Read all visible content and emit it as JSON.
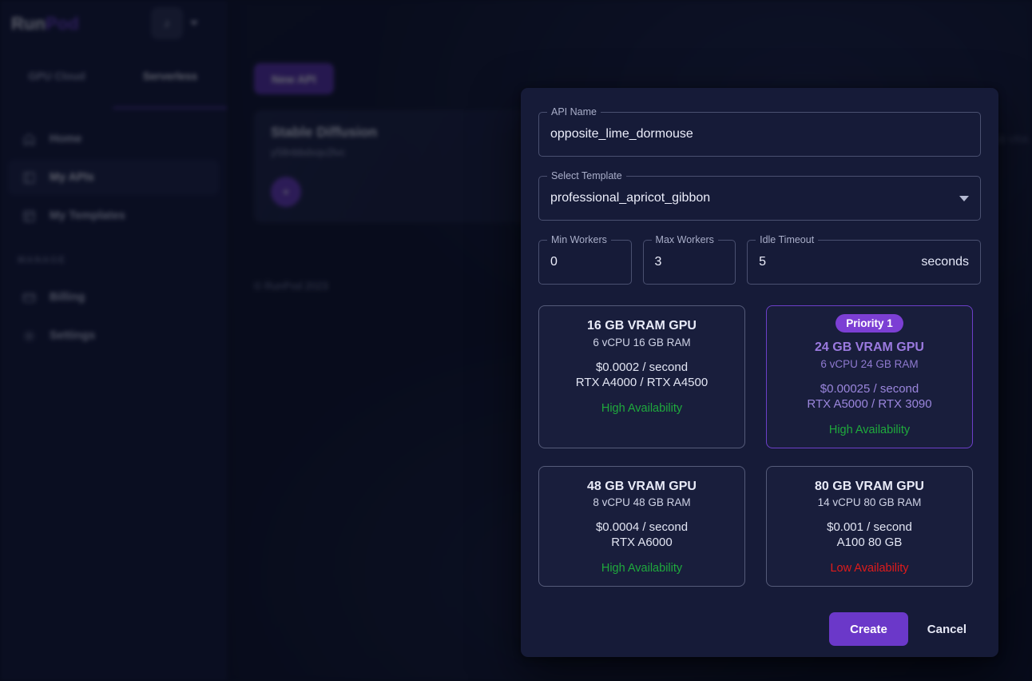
{
  "brand": {
    "name_first": "Run",
    "name_second": "Pod",
    "avatar_glyph": "♪"
  },
  "sidebar": {
    "tabs": [
      {
        "label": "GPU Cloud",
        "active": false
      },
      {
        "label": "Serverless",
        "active": true
      }
    ],
    "items": [
      {
        "label": "Home",
        "icon": "home-icon",
        "active": false
      },
      {
        "label": "My APIs",
        "icon": "apis-icon",
        "active": true
      },
      {
        "label": "My Templates",
        "icon": "templates-icon",
        "active": false
      }
    ],
    "section_label": "MANAGE",
    "manage_items": [
      {
        "label": "Billing",
        "icon": "billing-icon"
      },
      {
        "label": "Settings",
        "icon": "gear-icon"
      }
    ]
  },
  "main": {
    "new_api_label": "New API",
    "api_card": {
      "title": "Stable Diffusion",
      "id": "y58nbbdxqv2lvc",
      "expand_glyph": "▾"
    },
    "footer": "© RunPod 2023",
    "right_peek_text": "GB VRA"
  },
  "modal": {
    "api_name": {
      "label": "API Name",
      "value": "opposite_lime_dormouse",
      "placeholder": "API Name"
    },
    "template": {
      "label": "Select Template",
      "value": "professional_apricot_gibbon"
    },
    "min_workers": {
      "label": "Min Workers",
      "value": "0"
    },
    "max_workers": {
      "label": "Max Workers",
      "value": "3"
    },
    "idle_timeout": {
      "label": "Idle Timeout",
      "value": "5",
      "suffix": "seconds"
    },
    "gpu_cards": [
      {
        "badge": null,
        "title": "16 GB VRAM GPU",
        "spec": "6 vCPU 16 GB RAM",
        "price": "$0.0002 / second",
        "models": "RTX A4000 / RTX A4500",
        "availability": "High Availability",
        "availability_color": "#1faa3c",
        "selected": false
      },
      {
        "badge": "Priority 1",
        "title": "24 GB VRAM GPU",
        "spec": "6 vCPU 24 GB RAM",
        "price": "$0.00025 / second",
        "models": "RTX A5000 / RTX 3090",
        "availability": "High Availability",
        "availability_color": "#1faa3c",
        "selected": true
      },
      {
        "badge": null,
        "title": "48 GB VRAM GPU",
        "spec": "8 vCPU 48 GB RAM",
        "price": "$0.0004 / second",
        "models": "RTX A6000",
        "availability": "High Availability",
        "availability_color": "#1faa3c",
        "selected": false
      },
      {
        "badge": null,
        "title": "80 GB VRAM GPU",
        "spec": "14 vCPU 80 GB RAM",
        "price": "$0.001 / second",
        "models": "A100 80 GB",
        "availability": "Low Availability",
        "availability_color": "#e01b1b",
        "selected": false
      }
    ],
    "create_label": "Create",
    "cancel_label": "Cancel"
  },
  "colors": {
    "accent_purple": "#6b38c9",
    "badge_purple": "#7c3fd4",
    "selected_border": "#6c3fc9",
    "high_availability": "#1faa3c",
    "low_availability": "#e01b1b",
    "modal_bg": "#161b38",
    "sidebar_bg": "#111634"
  }
}
